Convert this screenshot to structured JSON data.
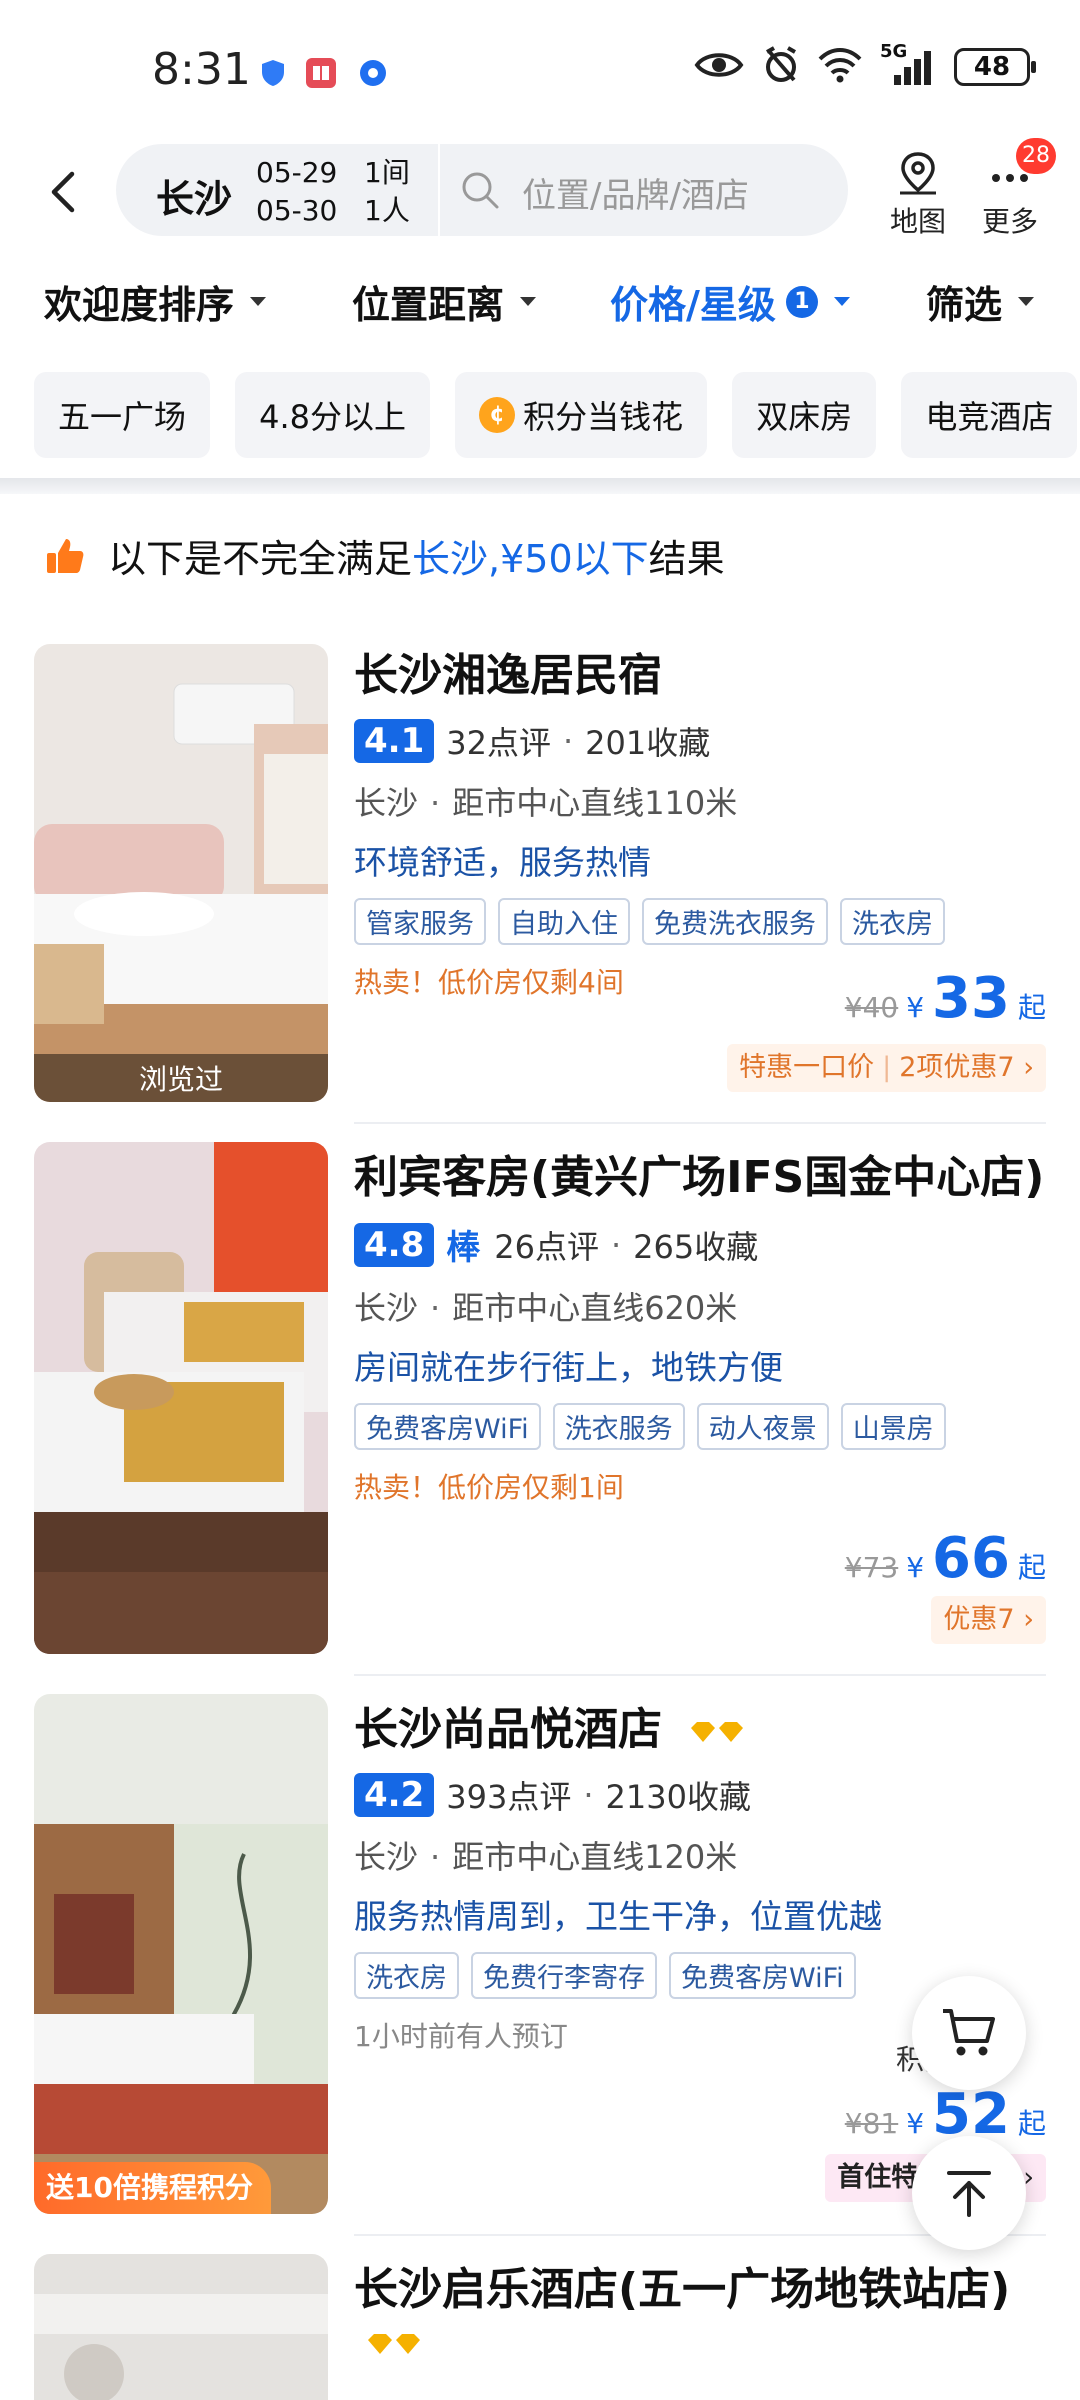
{
  "status": {
    "time": "8:31",
    "battery": "48",
    "network": "5G"
  },
  "search": {
    "city": "长沙",
    "checkin": "05-29",
    "checkout": "05-30",
    "rooms": "1间",
    "guests": "1人",
    "placeholder": "位置/品牌/酒店"
  },
  "header": {
    "map_label": "地图",
    "more_label": "更多",
    "more_badge": "28"
  },
  "sort": [
    {
      "label": "欢迎度排序"
    },
    {
      "label": "位置距离"
    },
    {
      "label": "价格/星级",
      "badge": "1"
    },
    {
      "label": "筛选"
    }
  ],
  "chips": [
    "五一广场",
    "4.8分以上",
    "积分当钱花",
    "双床房",
    "电竞酒店"
  ],
  "notice": {
    "prefix": "以下是不完全满足",
    "highlight": "长沙,¥50以下",
    "suffix": "结果"
  },
  "hotels": [
    {
      "name": "长沙湘逸居民宿",
      "score": "4.1",
      "reviews": "32点评",
      "favs": "201收藏",
      "city": "长沙",
      "distance": "距市中心直线110米",
      "desc": "环境舒适，服务热情",
      "tags": [
        "管家服务",
        "自助入住",
        "免费洗衣服务",
        "洗衣房"
      ],
      "hot": "热卖！低价房仅剩4间",
      "orig_price": "¥40",
      "price": "33",
      "price_suffix": "起",
      "promo_a": "特惠一口价",
      "promo_b": "2项优惠7",
      "viewed": "浏览过"
    },
    {
      "name": "利宾客房(黄兴广场IFS国金中心店)",
      "score": "4.8",
      "score_word": "棒",
      "reviews": "26点评",
      "favs": "265收藏",
      "city": "长沙",
      "distance": "距市中心直线620米",
      "desc": "房间就在步行街上，地铁方便",
      "tags": [
        "免费客房WiFi",
        "洗衣服务",
        "动人夜景",
        "山景房"
      ],
      "hot": "热卖！低价房仅剩1间",
      "orig_price": "¥73",
      "price": "66",
      "price_suffix": "起",
      "promo_b": "优惠7"
    },
    {
      "name": "长沙尚品悦酒店",
      "score": "4.2",
      "reviews": "393点评",
      "favs": "2130收藏",
      "city": "长沙",
      "distance": "距市中心直线120米",
      "desc": "服务热情周到，卫生干净，位置优越",
      "tags": [
        "洗衣房",
        "免费行李寄存",
        "免费客房WiFi"
      ],
      "hot": "1小时前有人预订",
      "points_text": "积分",
      "orig_price": "¥81",
      "price": "52",
      "price_suffix": "起",
      "promo_a": "首住特惠",
      "promo_b": "2项",
      "photo_banner": "送10倍携程积分"
    },
    {
      "name": "长沙启乐酒店(五一广场地铁站店)"
    }
  ],
  "colors": {
    "accent": "#1568e5",
    "hot": "#e0752b",
    "badge": "#ff3b30"
  }
}
